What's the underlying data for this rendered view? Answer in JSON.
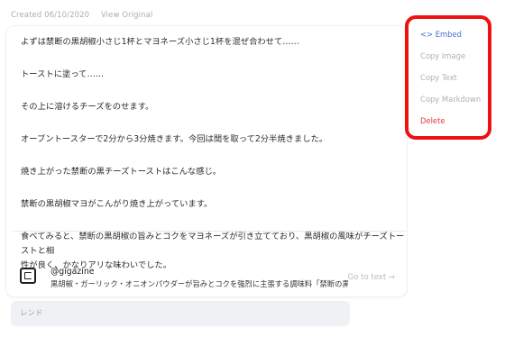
{
  "meta": {
    "created": "Created 06/10/2020",
    "view_original": "View Original"
  },
  "note": {
    "paragraphs": [
      "よずは禁断の黒胡椒小さじ1杯とマヨネーズ小さじ1杯を混ぜ合わせて……",
      "トーストに塗って……",
      "その上に溶けるチーズをのせます。",
      "オーブントースターで2分から3分焼きます。今回は間を取って2分半焼きました。",
      "焼き上がった禁断の黒チーズトーストはこんな感じ。",
      "禁断の黒胡椒マヨがこんがり焼き上がっています。"
    ],
    "final_lines": [
      "食べてみると、禁断の黒胡椒の旨みとコクをマヨネーズが引き立てており、黒胡椒の風味がチーズトーストと相",
      "性が良く、かなりアリな味わいでした。"
    ]
  },
  "link_card": {
    "handle": "@gigazine",
    "description": "黒胡椒・ガーリック・オニオンパウダーが旨みとコクを強烈に主張する調味料「禁断の黒胡...",
    "goto": "Go to text →",
    "icon": "gigazine-logo-icon"
  },
  "reply": {
    "value": "",
    "placeholder": "レンド"
  },
  "menu": {
    "items": [
      {
        "id": "embed",
        "label": "<> Embed"
      },
      {
        "id": "copy-image",
        "label": "Copy Image"
      },
      {
        "id": "copy-text",
        "label": "Copy Text"
      },
      {
        "id": "copy-markdown",
        "label": "Copy Markdown"
      },
      {
        "id": "delete",
        "label": "Delete"
      }
    ]
  },
  "colors": {
    "accent": "#4a6fcf",
    "danger": "#e5383b",
    "highlight": "#ee1111",
    "muted": "#aab2ba"
  }
}
